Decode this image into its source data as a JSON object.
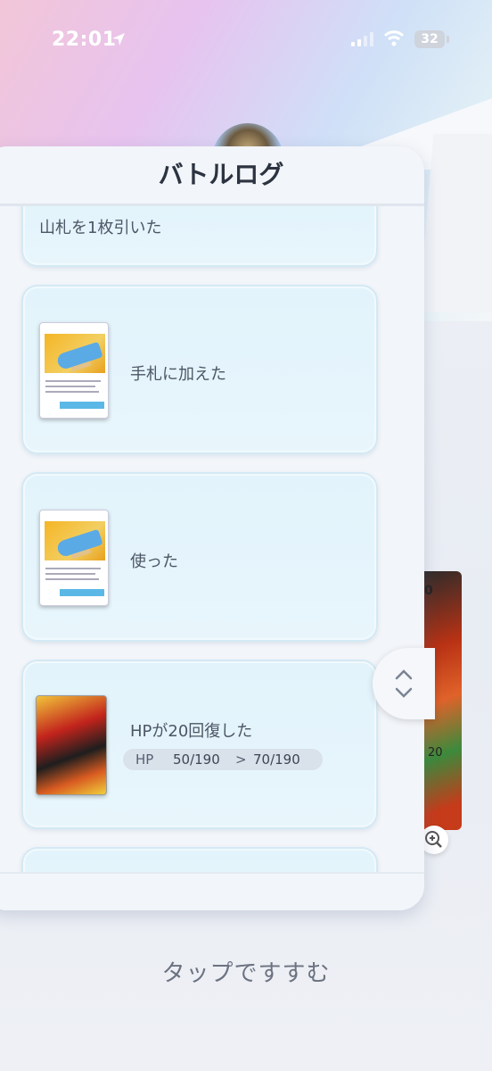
{
  "status_bar": {
    "time": "22:01",
    "battery": "32"
  },
  "modal": {
    "title": "バトルログ"
  },
  "log_entries": [
    {
      "text": "山札を1枚引いた"
    },
    {
      "text": "手札に加えた",
      "card": "item-card"
    },
    {
      "text": "使った",
      "card": "item-card"
    },
    {
      "text": "HPが20回復した",
      "card": "pokemon-card",
      "hp": {
        "label": "HP",
        "before": "50/190",
        "arrow": ">",
        "after": "70/190"
      }
    }
  ],
  "card_peek": {
    "top_text": "0",
    "mid_text": "20"
  },
  "footer": {
    "tap_hint": "タップですすむ"
  },
  "colors": {
    "accent": "#e2f3fb",
    "title": "#2c3340"
  }
}
